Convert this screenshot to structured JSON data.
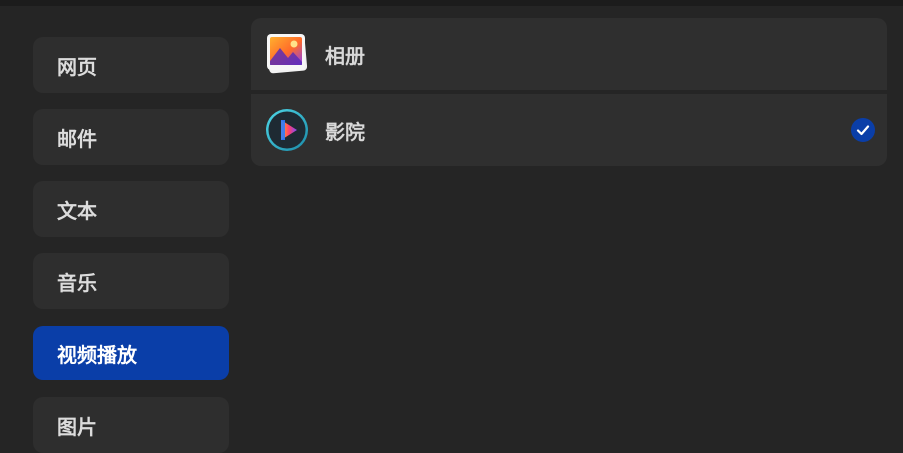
{
  "categories": [
    {
      "label": "网页",
      "active": false
    },
    {
      "label": "邮件",
      "active": false
    },
    {
      "label": "文本",
      "active": false
    },
    {
      "label": "音乐",
      "active": false
    },
    {
      "label": "视频播放",
      "active": true
    },
    {
      "label": "图片",
      "active": false
    }
  ],
  "apps": [
    {
      "name": "相册",
      "icon": "photos-icon",
      "selected": false
    },
    {
      "name": "影院",
      "icon": "cinema-icon",
      "selected": true
    }
  ],
  "colors": {
    "accent": "#0a3ea8",
    "background": "#252525",
    "panel": "#2f2f2f"
  }
}
